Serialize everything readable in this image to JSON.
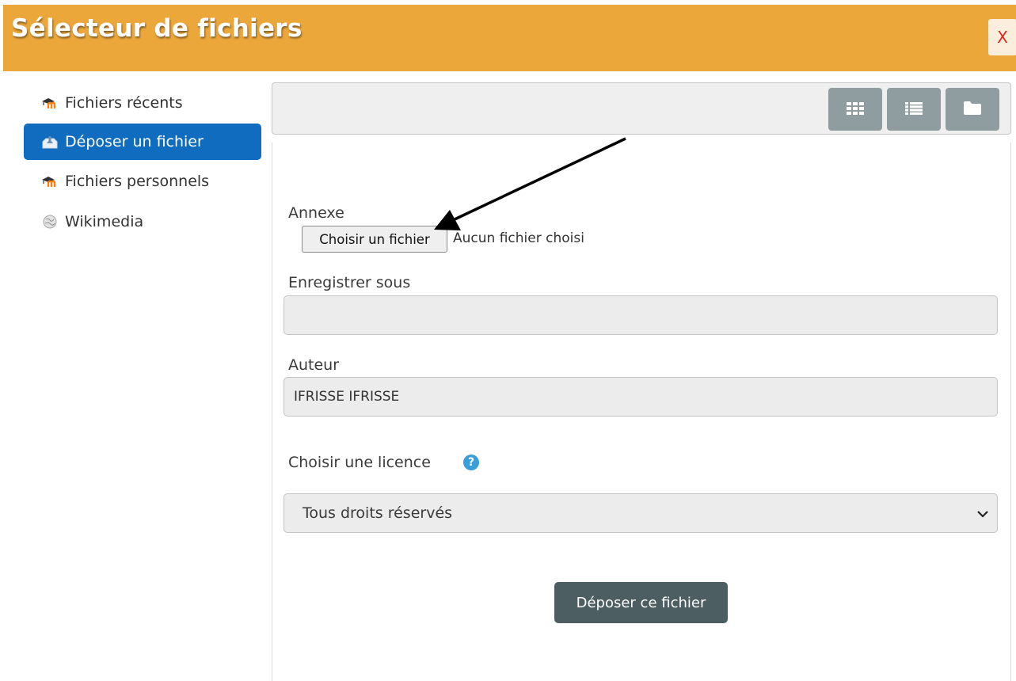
{
  "dialog": {
    "title": "Sélecteur de fichiers",
    "close_label": "X"
  },
  "sidebar": {
    "items": [
      {
        "label": "Fichiers récents",
        "icon": "moodle-icon",
        "active": false
      },
      {
        "label": "Déposer un fichier",
        "icon": "upload-icon",
        "active": true
      },
      {
        "label": "Fichiers personnels",
        "icon": "moodle-icon",
        "active": false
      },
      {
        "label": "Wikimedia",
        "icon": "wikimedia-globe-icon",
        "active": false
      }
    ]
  },
  "toolbar": {
    "views": [
      "grid-view-icon",
      "list-view-icon",
      "folder-view-icon"
    ]
  },
  "form": {
    "attachment_label": "Annexe",
    "choose_file_label": "Choisir un fichier",
    "no_file_text": "Aucun fichier choisi",
    "save_as_label": "Enregistrer sous",
    "save_as_value": "",
    "author_label": "Auteur",
    "author_value": "IFRISSE IFRISSE",
    "license_label": "Choisir une licence",
    "license_selected": "Tous droits réservés",
    "submit_label": "Déposer ce fichier"
  },
  "colors": {
    "header": "#eca73a",
    "active_item": "#0f6cbf",
    "view_button": "#8f9ca0",
    "submit_button": "#4d5e63",
    "help_icon": "#3a9fd8",
    "close_text": "#e0271d"
  }
}
